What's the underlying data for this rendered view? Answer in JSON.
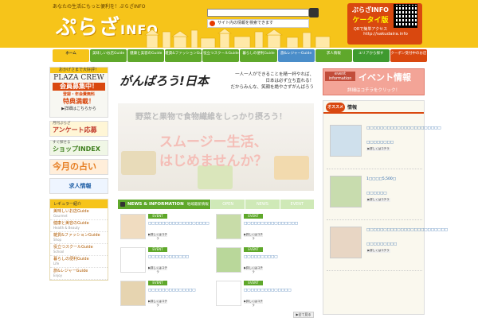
{
  "header": {
    "tagline": "あなたの生活にもっと便利を！ぷらざINFO",
    "logo_main": "ぷらざ",
    "logo_sub": "INFO",
    "search_placeholder": "",
    "search_note": "サイト内の情報を検索できます",
    "mobile": {
      "line1": "ぷらざINFO",
      "line2": "ケータイ版",
      "line3": "QRで簡単アクセス",
      "url": "http://sakudaira.info"
    }
  },
  "nav": [
    {
      "label": "ホーム"
    },
    {
      "label": "美味しいお店Guide"
    },
    {
      "label": "健康と美容のGuide"
    },
    {
      "label": "雑貨&ファッションGuide"
    },
    {
      "label": "役立つスクールGuide"
    },
    {
      "label": "暮らしの便利Guide"
    },
    {
      "label": "旅&レジャーGuide"
    },
    {
      "label": "求人情報"
    },
    {
      "label": "エリアから探す"
    },
    {
      "label": "クーポン受付中のお店"
    }
  ],
  "left": {
    "plaza": {
      "top": "おかげさまで大好評！",
      "name": "PLAZA CREW",
      "recruit": "会員募集中！",
      "note": "登録・年会費無料",
      "tokuten": "特典満載！",
      "detail": "▶詳細はこちらから"
    },
    "enquete": {
      "l1": "月刊ぷらざ",
      "l2": "アンケート応募"
    },
    "shop_index": {
      "l1": "すぐ探せる",
      "l2": "ショップINDEX"
    },
    "fortune": {
      "l2": "今月の占い"
    },
    "jobs": {
      "l2": "求人情報"
    },
    "regular_head": "レギュラー紹介",
    "regular": [
      {
        "label": "美味しいお店Guide",
        "sub": "Gourmet"
      },
      {
        "label": "健康と美容のGuide",
        "sub": "Health & Beauty"
      },
      {
        "label": "雑貨&ファッションGuide",
        "sub": "Shop"
      },
      {
        "label": "役立つスクールGuide",
        "sub": "School"
      },
      {
        "label": "暮らしの便利Guide",
        "sub": "Life"
      },
      {
        "label": "旅&レジャーGuide",
        "sub": "Enjoy"
      }
    ]
  },
  "hero": {
    "logo": "がんばろう!日本",
    "message_1": "一人一人ができることを精一杯やれば、",
    "message_2": "日本は必ず立ち直れる！",
    "message_3": "だからみんな、笑顔を絶やさずがんばろう",
    "banner_1": "野菜と果物で食物繊維をしっかり摂ろう！",
    "banner_2": "スムージー生活、",
    "banner_3": "はじめませんか？"
  },
  "news": {
    "title": "NEWS & INFORMATION",
    "subtitle": "地域最新情報",
    "tabs": [
      "OPEN",
      "NEWS",
      "EVENT"
    ],
    "items": [
      {
        "badge": "EVENT",
        "text": "□□□□□□□□□□□□□□□□□□",
        "more": "▶詳しくはコチラ"
      },
      {
        "badge": "EVENT",
        "text": "□□□□□□□□□□□□□□□□",
        "more": "▶詳しくはコチラ"
      },
      {
        "badge": "EVENT",
        "text": "□□□□□□□□□□□□",
        "more": "▶詳しくはコチラ"
      },
      {
        "badge": "EVENT",
        "text": "□□□□□□□□□□",
        "more": "▶詳しくはコチラ"
      },
      {
        "badge": "EVENT",
        "text": "□□□□□□□□□□□□□□",
        "more": "▶詳しくはコチラ"
      },
      {
        "badge": "EVENT",
        "text": "□□□□□□□□□□□□□□",
        "more": "▶詳しくはコチラ"
      }
    ],
    "all": "▶全て見る"
  },
  "right": {
    "event": {
      "badge": "event information",
      "title": "イベント情報",
      "note": "詳細はコチラをクリック！"
    },
    "recommend_badge": "オススメ",
    "recommend_label": "情報",
    "items": [
      {
        "t1": "□□□□□□□□□□□□□□□□□□□□□□",
        "t2": "□□□□□□□□",
        "more": "▶詳しくはコチラ"
      },
      {
        "t1": "1□□□□5,500□",
        "t2": "□□□□□□",
        "more": "▶詳しくはコチラ"
      },
      {
        "t1": "□□□□□□□□□□□□□□□□□□□□□□□□",
        "t2": "□□□□□□□□□",
        "more": "▶詳しくはコチラ"
      }
    ]
  }
}
